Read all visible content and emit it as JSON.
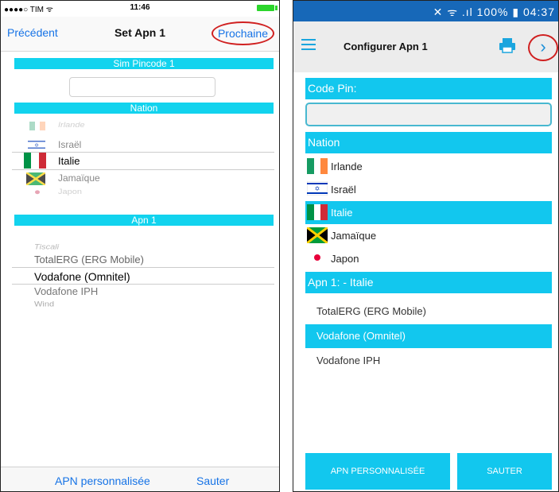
{
  "ios": {
    "status": {
      "carrier": "●●●●○ TIM ᯤ",
      "time": "11:46"
    },
    "nav": {
      "back": "Précédent",
      "title": "Set Apn 1",
      "next": "Prochaine"
    },
    "sections": {
      "pin": "Sim Pincode 1",
      "nation": "Nation",
      "apn": "Apn 1"
    },
    "nations": [
      "Irlande",
      "Israël",
      "Italie",
      "Jamaïque",
      "Japon"
    ],
    "selected_nation": "Italie",
    "apns": [
      "Tiscali",
      "TotalERG (ERG Mobile)",
      "Vodafone (Omnitel)",
      "Vodafone IPH",
      "Wind"
    ],
    "selected_apn": "Vodafone (Omnitel)",
    "bottom": {
      "custom": "APN personnalisée",
      "skip": "Sauter"
    }
  },
  "android": {
    "status": {
      "icons": "✕ ᯤ .ıl 100% ▮ 04:37"
    },
    "appbar": {
      "title": "Configurer Apn 1",
      "next_glyph": "›"
    },
    "sections": {
      "pin": "Code Pin:",
      "nation": "Nation",
      "apn": "Apn 1: - Italie"
    },
    "nations": [
      "Irlande",
      "Israël",
      "Italie",
      "Jamaïque",
      "Japon"
    ],
    "selected_nation": "Italie",
    "apns": [
      "TotalERG (ERG Mobile)",
      "Vodafone (Omnitel)",
      "Vodafone IPH"
    ],
    "selected_apn": "Vodafone (Omnitel)",
    "buttons": {
      "custom": "APN PERSONNALISÉE",
      "skip": "SAUTER"
    }
  },
  "colors": {
    "accent": "#12c7ee",
    "ios_link": "#1673e6",
    "android_status": "#1768b8",
    "highlight_ring": "#d02020"
  },
  "icons": [
    "menu-icon",
    "printer-icon",
    "chevron-right-icon",
    "wifi-icon",
    "signal-icon",
    "battery-icon"
  ]
}
